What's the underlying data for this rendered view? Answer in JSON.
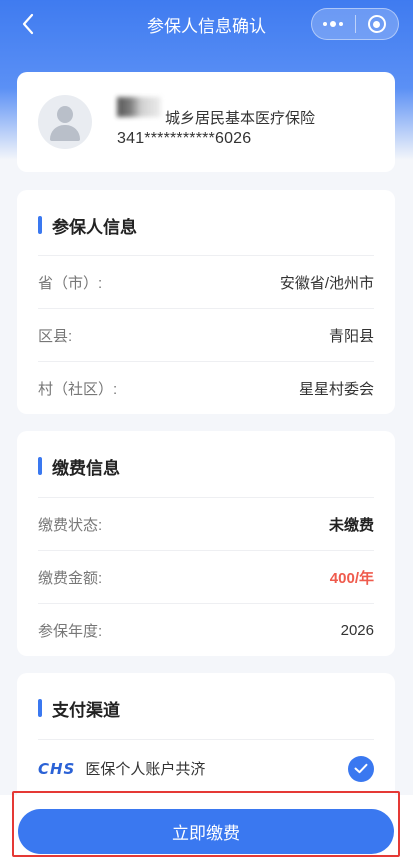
{
  "navbar": {
    "title": "参保人信息确认",
    "back_icon": "chevron-left-icon",
    "more_icon": "more-dots-icon",
    "close_icon": "target-circle-icon"
  },
  "profile": {
    "insurance_type": "城乡居民基本医疗保险",
    "id_number": "341***********6026"
  },
  "insured_info": {
    "title": "参保人信息",
    "rows": [
      {
        "label": "省（市）:",
        "value": "安徽省/池州市"
      },
      {
        "label": "区县:",
        "value": "青阳县"
      },
      {
        "label": "村（社区）:",
        "value": "星星村委会"
      }
    ]
  },
  "payment_info": {
    "title": "缴费信息",
    "rows": [
      {
        "label": "缴费状态:",
        "value": "未缴费"
      },
      {
        "label": "缴费金额:",
        "value": "400/年"
      },
      {
        "label": "参保年度:",
        "value": "2026"
      }
    ]
  },
  "payment_channel": {
    "title": "支付渠道",
    "logo_text": "CHS",
    "option_label": "医保个人账户共济"
  },
  "actions": {
    "pay_label": "立即缴费"
  },
  "colors": {
    "primary": "#3a78f0",
    "amount_red": "#ef5b4d",
    "highlight_border": "#e53935"
  }
}
